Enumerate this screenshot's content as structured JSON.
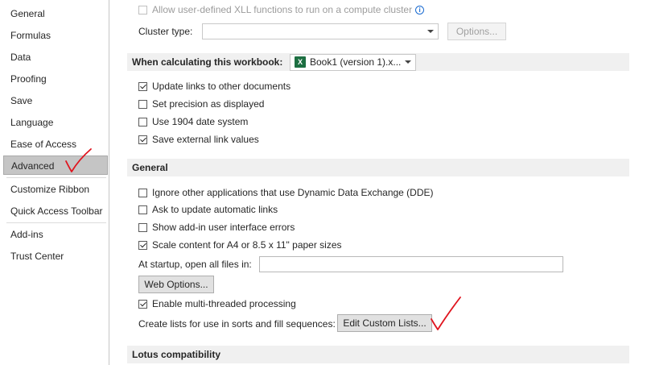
{
  "sidebar": {
    "items": [
      {
        "label": "General"
      },
      {
        "label": "Formulas"
      },
      {
        "label": "Data"
      },
      {
        "label": "Proofing"
      },
      {
        "label": "Save"
      },
      {
        "label": "Language"
      },
      {
        "label": "Ease of Access"
      },
      {
        "label": "Advanced",
        "active": true
      },
      {
        "label": "Customize Ribbon"
      },
      {
        "label": "Quick Access Toolbar"
      },
      {
        "label": "Add-ins"
      },
      {
        "label": "Trust Center"
      }
    ]
  },
  "cluster": {
    "xll_label": "Allow user-defined XLL functions to run on a compute cluster",
    "cluster_type_label": "Cluster type:",
    "cluster_type_value": "",
    "options_button": "Options..."
  },
  "calc_section": {
    "header": "When calculating this workbook:",
    "workbook_select": "Book1 (version 1).x...",
    "options": [
      {
        "label": "Update links to other documents",
        "checked": true
      },
      {
        "label": "Set precision as displayed",
        "checked": false
      },
      {
        "label": "Use 1904 date system",
        "checked": false
      },
      {
        "label": "Save external link values",
        "checked": true
      }
    ]
  },
  "general_section": {
    "header": "General",
    "options": [
      {
        "label": "Ignore other applications that use Dynamic Data Exchange (DDE)",
        "checked": false
      },
      {
        "label": "Ask to update automatic links",
        "checked": false
      },
      {
        "label": "Show add-in user interface errors",
        "checked": false
      },
      {
        "label": "Scale content for A4 or 8.5 x 11\" paper sizes",
        "checked": true
      }
    ],
    "startup_label": "At startup, open all files in:",
    "startup_value": "",
    "web_options_button": "Web Options...",
    "multithread_label": "Enable multi-threaded processing",
    "multithread_checked": true,
    "custom_lists_label": "Create lists for use in sorts and fill sequences:",
    "edit_custom_lists_button": "Edit Custom Lists..."
  },
  "lotus_section": {
    "header": "Lotus compatibility"
  },
  "colors": {
    "active_nav": "#c5c5c5",
    "section_bg": "#f0f0f0",
    "excel_green": "#1d6f42",
    "annotation_red": "#e0141e"
  }
}
